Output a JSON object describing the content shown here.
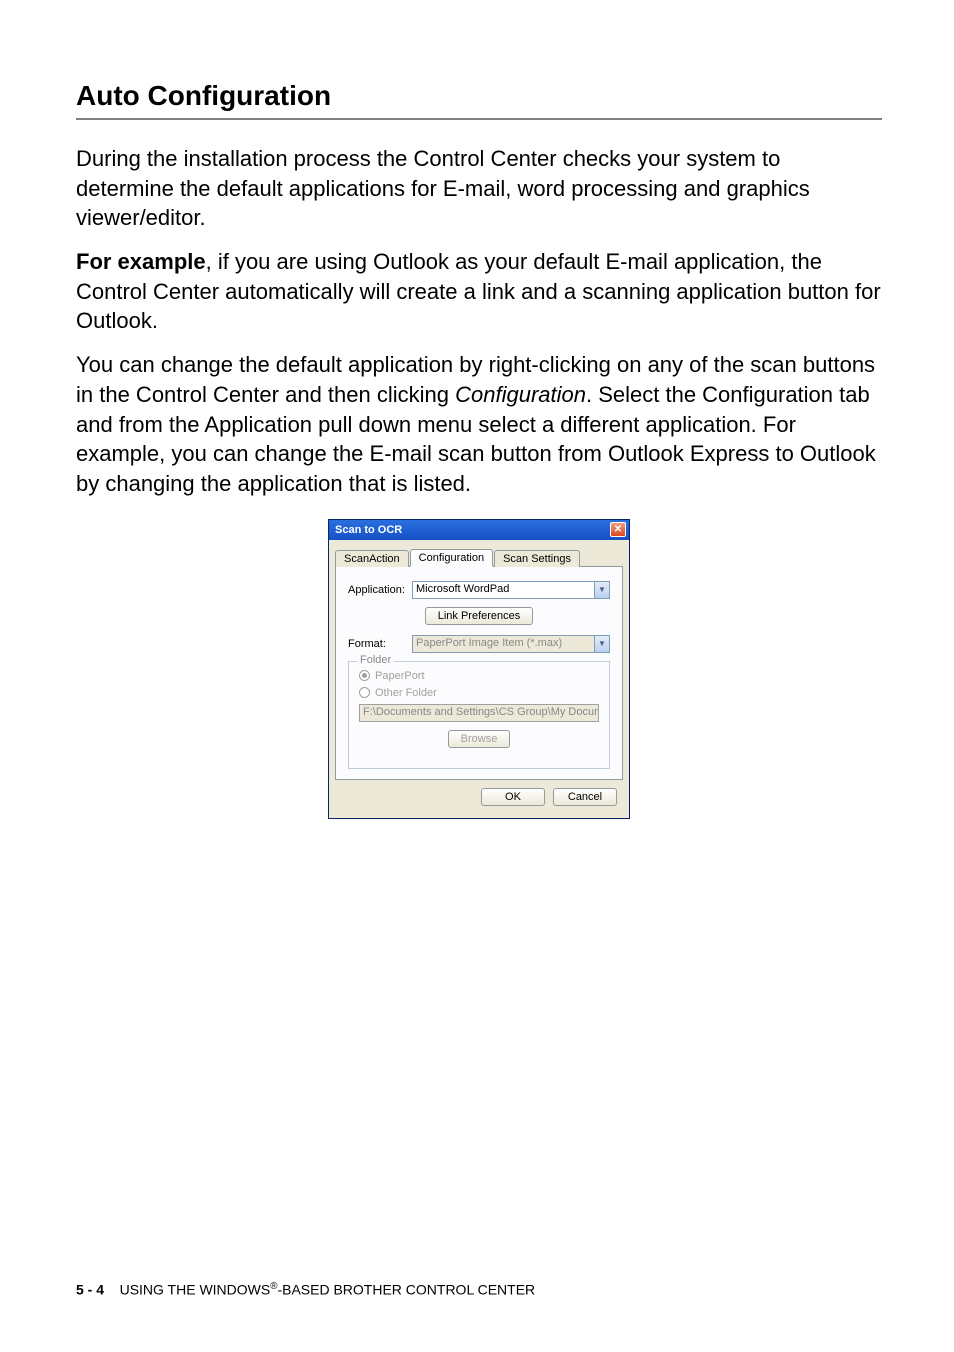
{
  "heading": "Auto Configuration",
  "para1": "During the installation process the Control Center checks your system to determine the default applications for E-mail, word processing and graphics viewer/editor.",
  "para2_lead": "For example",
  "para2_rest": ", if you are using Outlook as your default E-mail application, the Control Center automatically will create a link and a scanning application button for Outlook.",
  "para3_a": "You can change the default application by right-clicking on any of the scan buttons in the Control Center and then clicking ",
  "para3_config": "Configuration",
  "para3_b": ". Select the Configuration tab and from the Application pull down menu select a different application. For example, you can change the E-mail scan button from Outlook Express to Outlook by changing the application that is listed.",
  "dialog": {
    "title": "Scan to OCR",
    "tabs": {
      "t1": "ScanAction",
      "t2": "Configuration",
      "t3": "Scan Settings"
    },
    "application_label": "Application:",
    "application_value": "Microsoft WordPad",
    "link_prefs": "Link Preferences",
    "format_label": "Format:",
    "format_value": "PaperPort Image Item (*.max)",
    "folder_legend": "Folder",
    "radio1": "PaperPort",
    "radio2": "Other Folder",
    "path": "F:\\Documents and Settings\\CS Group\\My Documents\\My P",
    "browse": "Browse",
    "ok": "OK",
    "cancel": "Cancel"
  },
  "footer": {
    "page": "5 - 4",
    "text_a": "USING THE WINDOWS",
    "reg": "®",
    "text_b": "-BASED BROTHER CONTROL CENTER"
  }
}
